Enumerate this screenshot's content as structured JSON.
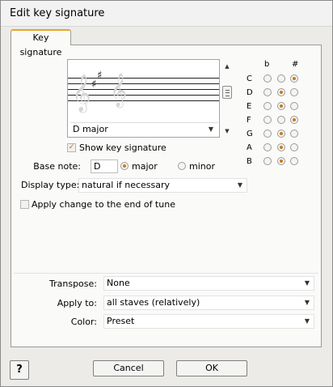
{
  "window": {
    "title": "Edit key signature"
  },
  "tabs": [
    {
      "label": "Key signature"
    }
  ],
  "preview": {
    "key_select_value": "D  major",
    "clef_icon": "treble-clef-icon",
    "accidental_icon": "sharp-icon"
  },
  "accidentals": {
    "flat_header": "b",
    "sharp_header": "#",
    "rows": [
      {
        "note": "C",
        "selected": "sharp"
      },
      {
        "note": "D",
        "selected": "natural"
      },
      {
        "note": "E",
        "selected": "natural"
      },
      {
        "note": "F",
        "selected": "sharp"
      },
      {
        "note": "G",
        "selected": "natural"
      },
      {
        "note": "A",
        "selected": "natural"
      },
      {
        "note": "B",
        "selected": "natural"
      }
    ]
  },
  "show_key_signature": {
    "label": "Show key signature",
    "checked": true
  },
  "base_note": {
    "label": "Base note:",
    "value": "D",
    "major_label": "major",
    "minor_label": "minor",
    "mode": "major"
  },
  "display_type": {
    "label": "Display type:",
    "value": "natural if necessary"
  },
  "apply_to_end": {
    "label": "Apply change to the end of tune",
    "checked": false
  },
  "transpose": {
    "label": "Transpose:",
    "value": "None"
  },
  "apply_to": {
    "label": "Apply to:",
    "value": "all staves (relatively)"
  },
  "color": {
    "label": "Color:",
    "value": "Preset"
  },
  "buttons": {
    "cancel": "Cancel",
    "ok": "OK",
    "help": "?"
  },
  "colors": {
    "accent": "#e9a52a",
    "radio_dot": "#c77b20",
    "dialog_bg": "#ecebe7",
    "panel_bg": "#fafaf9"
  }
}
